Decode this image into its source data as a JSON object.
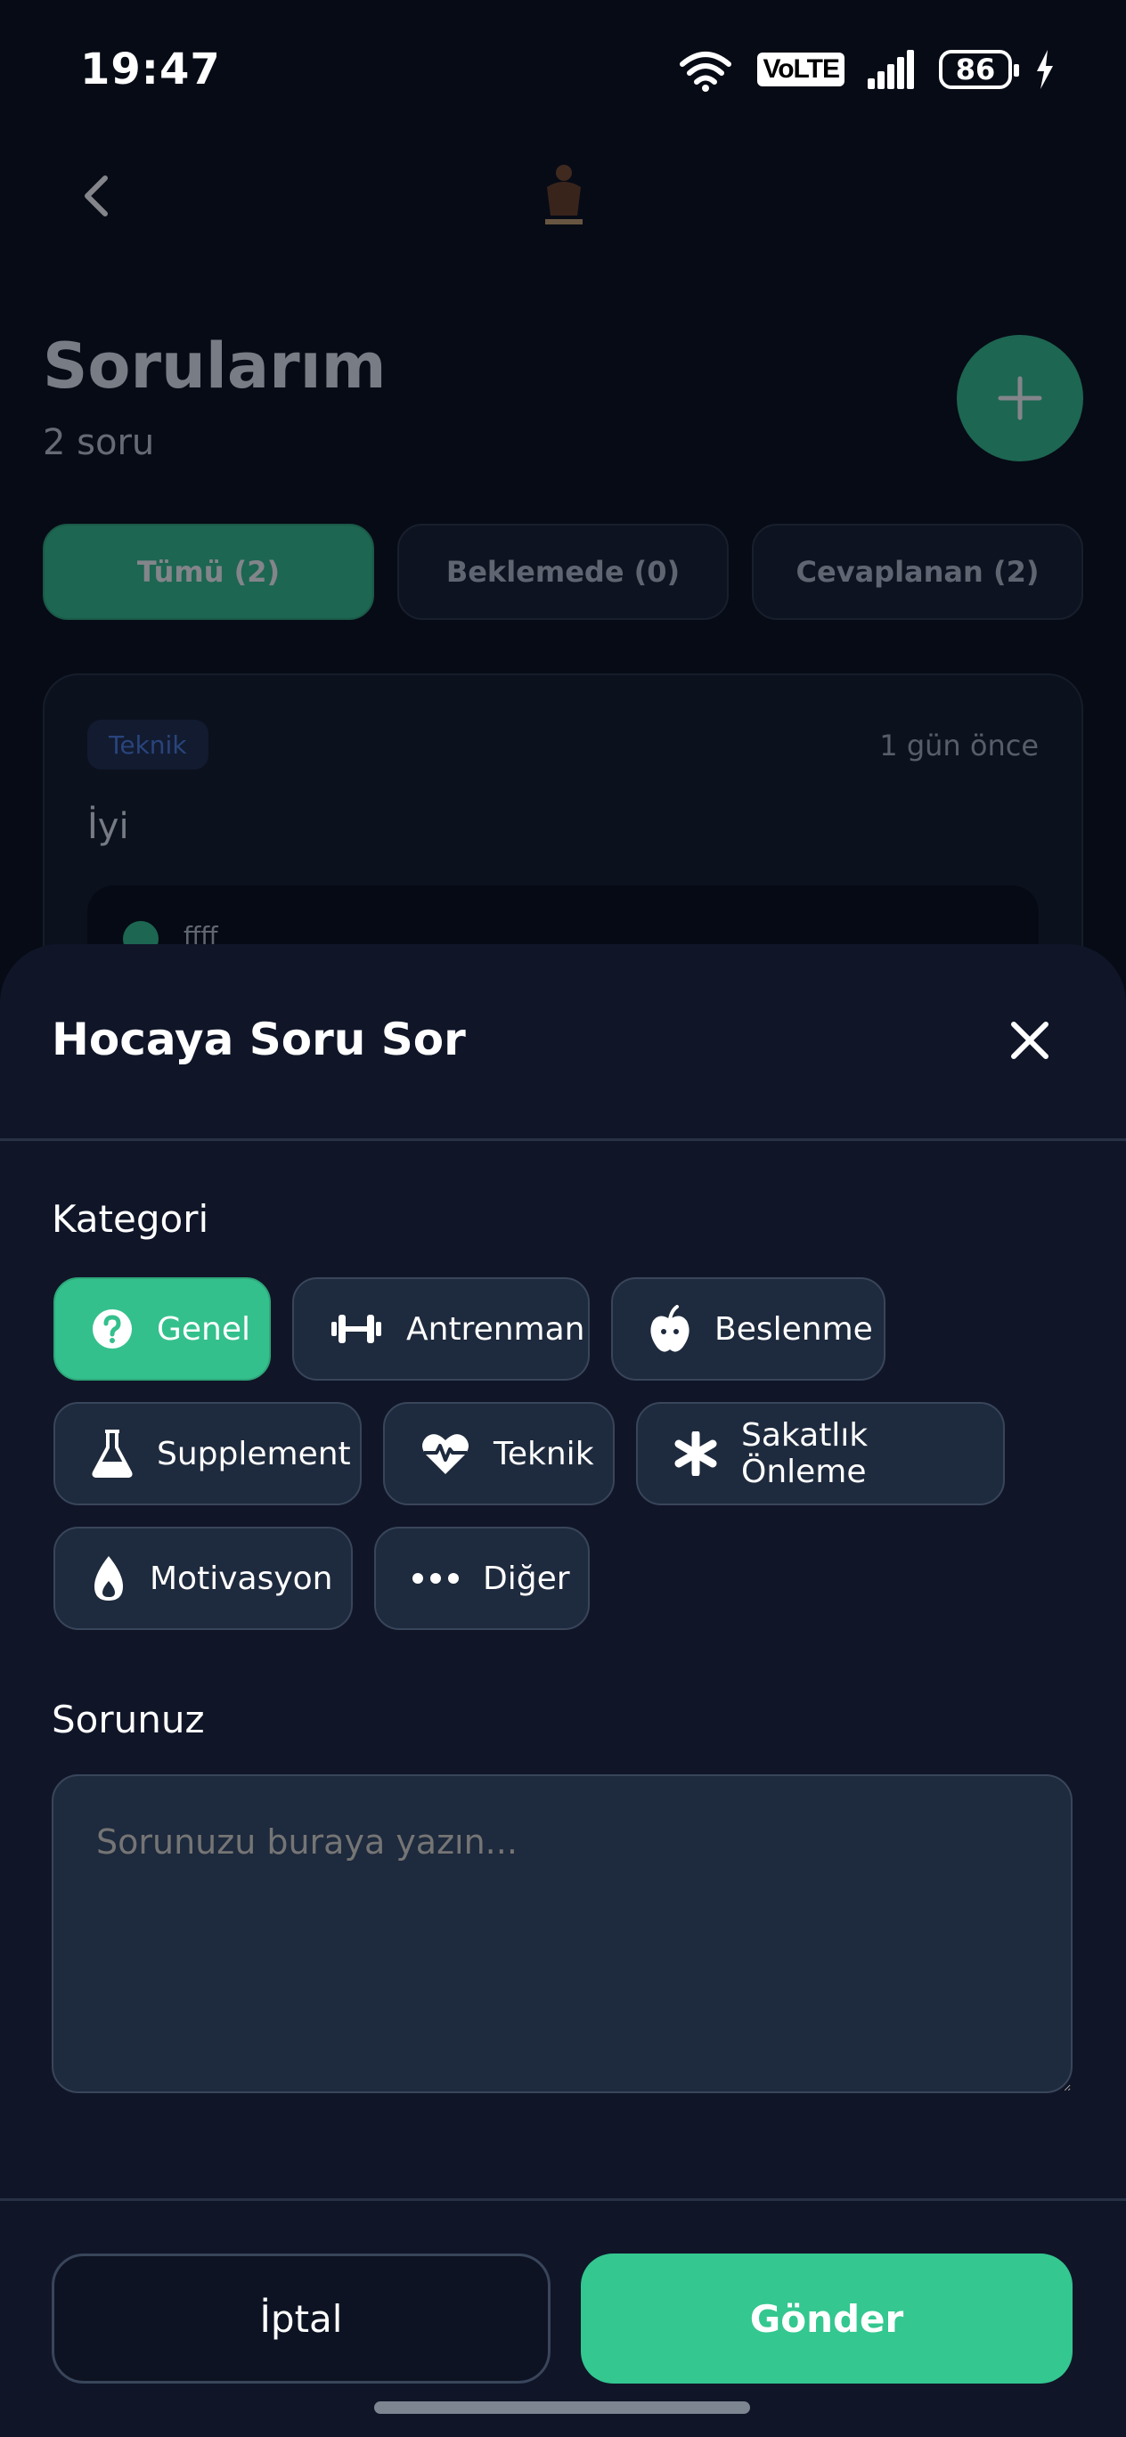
{
  "status_bar": {
    "time": "19:47",
    "network": "VoLTE",
    "battery": "86"
  },
  "page": {
    "title": "Sorularım",
    "subtitle": "2 soru",
    "filters": [
      {
        "label": "Tümü (2)",
        "active": true
      },
      {
        "label": "Beklemede (0)",
        "active": false
      },
      {
        "label": "Cevaplanan (2)",
        "active": false
      }
    ],
    "card": {
      "tag": "Teknik",
      "time_ago": "1 gün önce",
      "question": "İyi",
      "answer": "ffff"
    }
  },
  "sheet": {
    "title": "Hocaya Soru Sor",
    "category_label": "Kategori",
    "categories": [
      {
        "label": "Genel",
        "icon": "question-circle-icon",
        "selected": true
      },
      {
        "label": "Antrenman",
        "icon": "dumbbell-icon",
        "selected": false
      },
      {
        "label": "Beslenme",
        "icon": "apple-icon",
        "selected": false
      },
      {
        "label": "Supplement",
        "icon": "flask-icon",
        "selected": false
      },
      {
        "label": "Teknik",
        "icon": "heart-pulse-icon",
        "selected": false
      },
      {
        "label": "Sakatlık Önleme",
        "icon": "asterisk-icon",
        "selected": false
      },
      {
        "label": "Motivasyon",
        "icon": "flame-icon",
        "selected": false
      },
      {
        "label": "Diğer",
        "icon": "more-dots-icon",
        "selected": false
      }
    ],
    "question_label": "Sorunuz",
    "question_placeholder": "Sorunuzu buraya yazın...",
    "cancel_label": "İptal",
    "send_label": "Gönder"
  },
  "colors": {
    "accent": "#34c08d",
    "sheet_bg": "#101628",
    "chip_bg": "#1e2a3d"
  }
}
